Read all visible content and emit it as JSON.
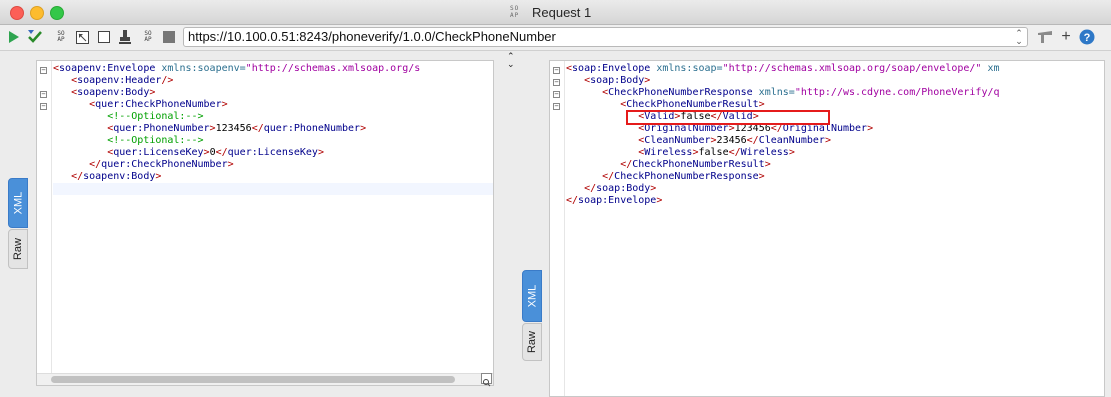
{
  "window": {
    "logo": "SO AP",
    "title": "Request 1"
  },
  "toolbar": {
    "url": "https://10.100.0.51:8243/phoneverify/1.0.0/CheckPhoneNumber",
    "buttons": [
      "play-icon",
      "check-icon",
      "soap-icon",
      "resize-icon",
      "stop-icon",
      "stamp-icon",
      "soap-icon",
      "square-icon"
    ],
    "right_icons": [
      "tool-icon",
      "plus-icon",
      "help-icon"
    ]
  },
  "request": {
    "tabs": {
      "xml": "XML",
      "raw": "Raw"
    },
    "lines": [
      [
        [
          "br",
          "<"
        ],
        [
          "tg",
          "soapenv:Envelope"
        ],
        [
          "at",
          " xmlns:soapenv="
        ],
        [
          "vl",
          "\"http://schemas.xmlsoap.org/s"
        ]
      ],
      [
        [
          "tx",
          "   "
        ],
        [
          "br",
          "<"
        ],
        [
          "tg",
          "soapenv:Header"
        ],
        [
          "br",
          "/>"
        ]
      ],
      [
        [
          "tx",
          "   "
        ],
        [
          "br",
          "<"
        ],
        [
          "tg",
          "soapenv:Body"
        ],
        [
          "br",
          ">"
        ]
      ],
      [
        [
          "tx",
          "      "
        ],
        [
          "br",
          "<"
        ],
        [
          "tg",
          "quer:CheckPhoneNumber"
        ],
        [
          "br",
          ">"
        ]
      ],
      [
        [
          "tx",
          "         "
        ],
        [
          "cm",
          "<!--Optional:-->"
        ]
      ],
      [
        [
          "tx",
          "         "
        ],
        [
          "br",
          "<"
        ],
        [
          "tg",
          "quer:PhoneNumber"
        ],
        [
          "br",
          ">"
        ],
        [
          "tx",
          "123456"
        ],
        [
          "br",
          "</"
        ],
        [
          "tg",
          "quer:PhoneNumber"
        ],
        [
          "br",
          ">"
        ]
      ],
      [
        [
          "tx",
          "         "
        ],
        [
          "cm",
          "<!--Optional:-->"
        ]
      ],
      [
        [
          "tx",
          "         "
        ],
        [
          "br",
          "<"
        ],
        [
          "tg",
          "quer:LicenseKey"
        ],
        [
          "br",
          ">"
        ],
        [
          "tx",
          "0"
        ],
        [
          "br",
          "</"
        ],
        [
          "tg",
          "quer:LicenseKey"
        ],
        [
          "br",
          ">"
        ]
      ],
      [
        [
          "tx",
          "      "
        ],
        [
          "br",
          "</"
        ],
        [
          "tg",
          "quer:CheckPhoneNumber"
        ],
        [
          "br",
          ">"
        ]
      ],
      [
        [
          "tx",
          "   "
        ],
        [
          "br",
          "</"
        ],
        [
          "tg",
          "soapenv:Body"
        ],
        [
          "br",
          ">"
        ]
      ],
      [
        [
          "br",
          "</"
        ],
        [
          "tg",
          "soapenv:Envelope"
        ],
        [
          "br",
          ">"
        ]
      ]
    ]
  },
  "response": {
    "tabs": {
      "xml": "XML",
      "raw": "Raw"
    },
    "lines": [
      [
        [
          "br",
          "<"
        ],
        [
          "tg",
          "soap:Envelope"
        ],
        [
          "at",
          " xmlns:soap="
        ],
        [
          "vl",
          "\"http://schemas.xmlsoap.org/soap/envelope/\""
        ],
        [
          "at",
          " xm"
        ]
      ],
      [
        [
          "tx",
          "   "
        ],
        [
          "br",
          "<"
        ],
        [
          "tg",
          "soap:Body"
        ],
        [
          "br",
          ">"
        ]
      ],
      [
        [
          "tx",
          "      "
        ],
        [
          "br",
          "<"
        ],
        [
          "tg",
          "CheckPhoneNumberResponse"
        ],
        [
          "at",
          " xmlns="
        ],
        [
          "vl",
          "\"http://ws.cdyne.com/PhoneVerify/q"
        ]
      ],
      [
        [
          "tx",
          "         "
        ],
        [
          "br",
          "<"
        ],
        [
          "tg",
          "CheckPhoneNumberResult"
        ],
        [
          "br",
          ">"
        ]
      ],
      [
        [
          "tx",
          "            "
        ],
        [
          "br",
          "<"
        ],
        [
          "tg",
          "Valid"
        ],
        [
          "br",
          ">"
        ],
        [
          "tx",
          "false"
        ],
        [
          "br",
          "</"
        ],
        [
          "tg",
          "Valid"
        ],
        [
          "br",
          ">"
        ]
      ],
      [
        [
          "tx",
          "            "
        ],
        [
          "br",
          "<"
        ],
        [
          "tg",
          "OriginalNumber"
        ],
        [
          "br",
          ">"
        ],
        [
          "tx",
          "123456"
        ],
        [
          "br",
          "</"
        ],
        [
          "tg",
          "OriginalNumber"
        ],
        [
          "br",
          ">"
        ]
      ],
      [
        [
          "tx",
          "            "
        ],
        [
          "br",
          "<"
        ],
        [
          "tg",
          "CleanNumber"
        ],
        [
          "br",
          ">"
        ],
        [
          "tx",
          "23456"
        ],
        [
          "br",
          "</"
        ],
        [
          "tg",
          "CleanNumber"
        ],
        [
          "br",
          ">"
        ]
      ],
      [
        [
          "tx",
          "            "
        ],
        [
          "br",
          "<"
        ],
        [
          "tg",
          "Wireless"
        ],
        [
          "br",
          ">"
        ],
        [
          "tx",
          "false"
        ],
        [
          "br",
          "</"
        ],
        [
          "tg",
          "Wireless"
        ],
        [
          "br",
          ">"
        ]
      ],
      [
        [
          "tx",
          "         "
        ],
        [
          "br",
          "</"
        ],
        [
          "tg",
          "CheckPhoneNumberResult"
        ],
        [
          "br",
          ">"
        ]
      ],
      [
        [
          "tx",
          "      "
        ],
        [
          "br",
          "</"
        ],
        [
          "tg",
          "CheckPhoneNumberResponse"
        ],
        [
          "br",
          ">"
        ]
      ],
      [
        [
          "tx",
          "   "
        ],
        [
          "br",
          "</"
        ],
        [
          "tg",
          "soap:Body"
        ],
        [
          "br",
          ">"
        ]
      ],
      [
        [
          "br",
          "</"
        ],
        [
          "tg",
          "soap:Envelope"
        ],
        [
          "br",
          ">"
        ]
      ]
    ]
  },
  "colors": {
    "highlight": "#e51b1b",
    "tab_active": "#4a90d9"
  }
}
